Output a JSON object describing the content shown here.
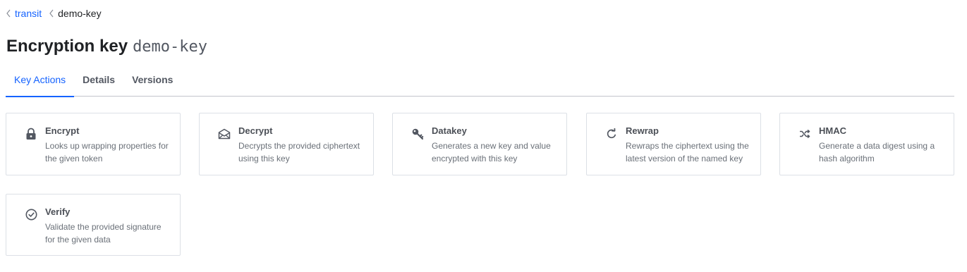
{
  "breadcrumb": {
    "items": [
      {
        "label": "transit",
        "link": true
      },
      {
        "label": "demo-key",
        "link": false
      }
    ]
  },
  "header": {
    "title": "Encryption key",
    "key_name": "demo-key"
  },
  "tabs": [
    {
      "label": "Key Actions",
      "active": true
    },
    {
      "label": "Details",
      "active": false
    },
    {
      "label": "Versions",
      "active": false
    }
  ],
  "actions": [
    {
      "title": "Encrypt",
      "description": "Looks up wrapping properties for the given token",
      "icon": "lock-icon"
    },
    {
      "title": "Decrypt",
      "description": "Decrypts the provided ciphertext using this key",
      "icon": "envelope-open-icon"
    },
    {
      "title": "Datakey",
      "description": "Generates a new key and value encrypted with this key",
      "icon": "key-icon"
    },
    {
      "title": "Rewrap",
      "description": "Rewraps the ciphertext using the latest version of the named key",
      "icon": "refresh-icon"
    },
    {
      "title": "HMAC",
      "description": "Generate a data digest using a hash algorithm",
      "icon": "shuffle-icon"
    },
    {
      "title": "Verify",
      "description": "Validate the provided signature for the given data",
      "icon": "check-circle-icon"
    }
  ],
  "colors": {
    "accent": "#1563ff",
    "text": "#1f2124",
    "muted": "#6a7078",
    "border": "#dce0e6"
  }
}
